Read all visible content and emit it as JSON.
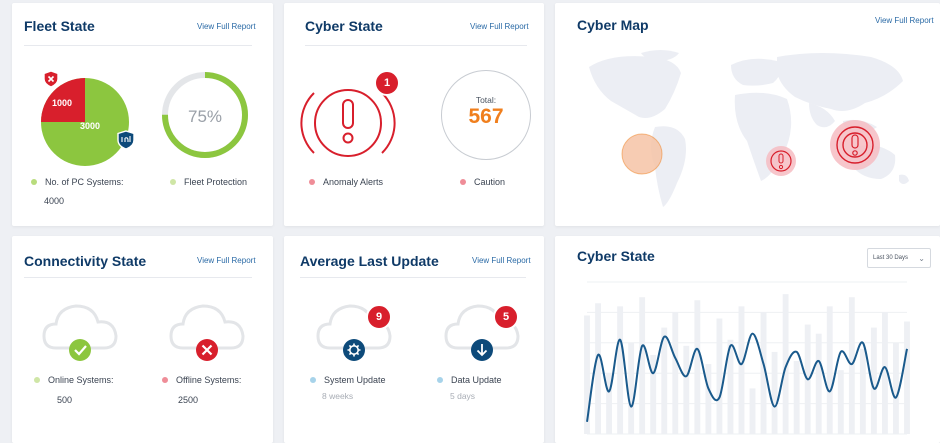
{
  "fleet_state": {
    "title": "Fleet State",
    "link": "View Full Report",
    "pie_red_value": "1000",
    "pie_green_value": "3000",
    "pie_red_fraction": 0.25,
    "ring_text": "75%",
    "ring_fraction": 0.75,
    "legend_systems": "No. of PC Systems:",
    "systems_value": "4000",
    "legend_protection": "Fleet Protection"
  },
  "cyber_state": {
    "title": "Cyber State",
    "link": "View Full Report",
    "alerts_badge": "1",
    "total_label": "Total:",
    "total_value": "567",
    "legend_alerts": "Anomaly Alerts",
    "legend_caution": "Caution"
  },
  "cyber_map": {
    "title": "Cyber Map",
    "link": "View Full Report"
  },
  "connectivity_state": {
    "title": "Connectivity State",
    "link": "View Full Report",
    "legend_online": "Online Systems:",
    "online_value": "500",
    "legend_offline": "Offline Systems:",
    "offline_value": "2500"
  },
  "average_last_update": {
    "title": "Average Last Update",
    "link": "View Full Report",
    "system_badge": "9",
    "data_badge": "5",
    "legend_system": "System Update",
    "system_value": "8 weeks",
    "legend_data": "Data Update",
    "data_value": "5 days"
  },
  "cyber_state_chart": {
    "title": "Cyber State",
    "dropdown_value": "Last 30 Days"
  },
  "colors": {
    "title": "#0f3a67",
    "link": "#2a6aa6",
    "red": "#d81f2c",
    "green": "#8cc63f",
    "orange": "#f07f1d",
    "navy": "#0d4a7a",
    "line": "#1a5a8c"
  },
  "chart_data": {
    "type": "line",
    "series": [
      {
        "values": [
          8,
          52,
          28,
          62,
          18,
          58,
          40,
          64,
          50,
          38,
          56,
          30,
          24,
          58,
          46,
          66,
          46,
          18,
          44,
          54,
          36,
          48,
          28,
          54,
          46,
          60,
          30,
          44,
          24,
          56
        ]
      },
      {
        "type": "bar",
        "values": [
          78,
          86,
          40,
          84,
          60,
          90,
          52,
          70,
          80,
          58,
          88,
          46,
          76,
          62,
          84,
          30,
          80,
          54,
          92,
          48,
          72,
          66,
          84,
          42,
          90,
          56,
          70,
          80,
          60,
          74
        ]
      }
    ],
    "ylim": [
      0,
      100
    ],
    "grid": true
  }
}
